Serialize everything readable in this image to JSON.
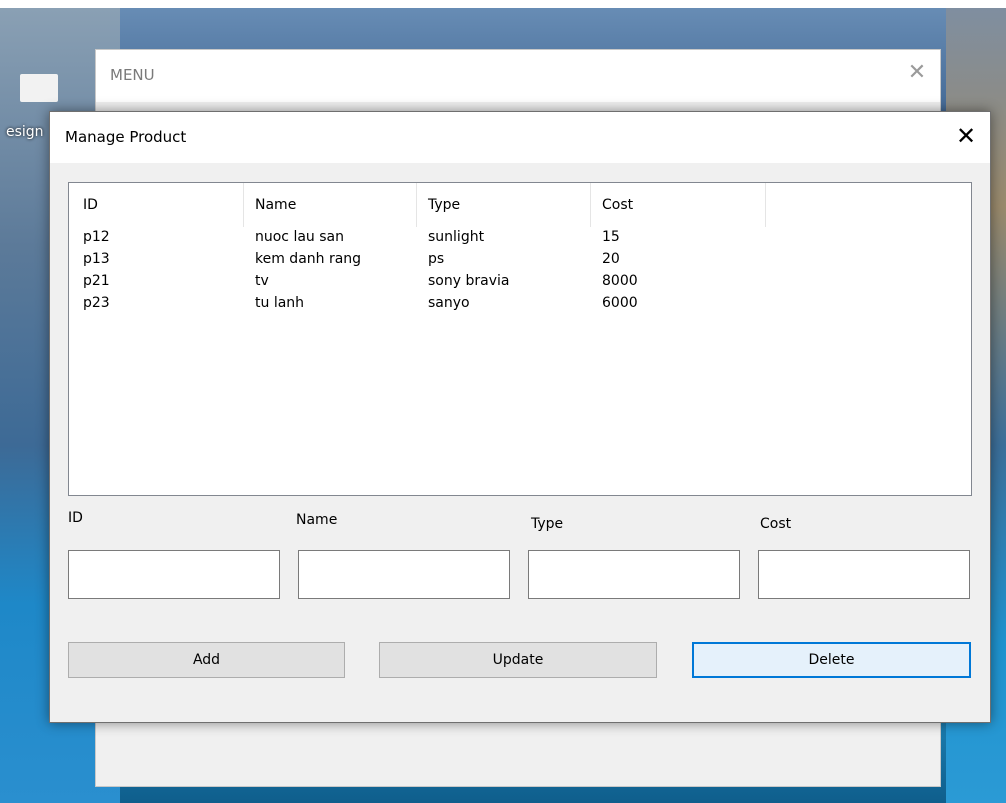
{
  "desktop": {
    "icon_label": "esign"
  },
  "menu_window": {
    "title": "MENU",
    "close_glyph": "✕"
  },
  "manage_window": {
    "title": "Manage Product",
    "close_glyph": "✕"
  },
  "product_list": {
    "columns": [
      "ID",
      "Name",
      "Type",
      "Cost"
    ],
    "rows": [
      [
        "p12",
        "nuoc lau san",
        "sunlight",
        "15"
      ],
      [
        "p13",
        "kem danh rang",
        "ps",
        "20"
      ],
      [
        "p21",
        "tv",
        "sony bravia",
        "8000"
      ],
      [
        "p23",
        "tu lanh",
        "sanyo",
        "6000"
      ]
    ]
  },
  "form": {
    "id_label": "ID",
    "name_label": "Name",
    "type_label": "Type",
    "cost_label": "Cost",
    "id_value": "",
    "name_value": "",
    "type_value": "",
    "cost_value": ""
  },
  "buttons": {
    "add": "Add",
    "update": "Update",
    "delete": "Delete"
  },
  "colors": {
    "accent": "#0078d7",
    "window_bg": "#f0f0f0"
  }
}
